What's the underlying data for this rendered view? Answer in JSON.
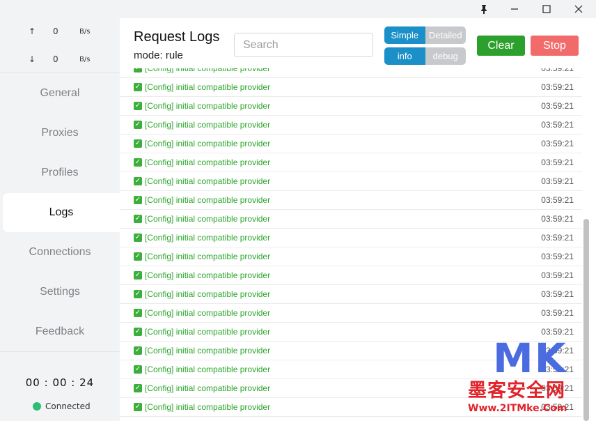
{
  "titlebar": {
    "pin_icon": "pin-icon",
    "minimize_icon": "minimize-icon",
    "maximize_icon": "maximize-icon",
    "close_icon": "close-icon"
  },
  "sidebar": {
    "upload": {
      "arrow": "↑",
      "value": "0",
      "unit": "B/s"
    },
    "download": {
      "arrow": "↓",
      "value": "0",
      "unit": "B/s"
    },
    "items": [
      {
        "label": "General"
      },
      {
        "label": "Proxies"
      },
      {
        "label": "Profiles"
      },
      {
        "label": "Logs"
      },
      {
        "label": "Connections"
      },
      {
        "label": "Settings"
      },
      {
        "label": "Feedback"
      }
    ],
    "active_item": "Logs",
    "timer": "00 : 00 : 24",
    "status": "Connected",
    "status_color": "#2bbf74"
  },
  "header": {
    "title": "Request Logs",
    "mode": "mode: rule",
    "search_placeholder": "Search",
    "view_toggle": {
      "simple": "Simple",
      "detailed": "Detailed",
      "selected": "Simple"
    },
    "level_toggle": {
      "info": "info",
      "debug": "debug",
      "selected": "info"
    },
    "clear_label": "Clear",
    "stop_label": "Stop"
  },
  "logs": [
    {
      "message": "[Config] initial compatible provider",
      "time": "03:59:21"
    },
    {
      "message": "[Config] initial compatible provider",
      "time": "03:59:21"
    },
    {
      "message": "[Config] initial compatible provider",
      "time": "03:59:21"
    },
    {
      "message": "[Config] initial compatible provider",
      "time": "03:59:21"
    },
    {
      "message": "[Config] initial compatible provider",
      "time": "03:59:21"
    },
    {
      "message": "[Config] initial compatible provider",
      "time": "03:59:21"
    },
    {
      "message": "[Config] initial compatible provider",
      "time": "03:59:21"
    },
    {
      "message": "[Config] initial compatible provider",
      "time": "03:59:21"
    },
    {
      "message": "[Config] initial compatible provider",
      "time": "03:59:21"
    },
    {
      "message": "[Config] initial compatible provider",
      "time": "03:59:21"
    },
    {
      "message": "[Config] initial compatible provider",
      "time": "03:59:21"
    },
    {
      "message": "[Config] initial compatible provider",
      "time": "03:59:21"
    },
    {
      "message": "[Config] initial compatible provider",
      "time": "03:59:21"
    },
    {
      "message": "[Config] initial compatible provider",
      "time": "03:59:21"
    },
    {
      "message": "[Config] initial compatible provider",
      "time": "03:59:21"
    },
    {
      "message": "[Config] initial compatible provider",
      "time": "03:59:21"
    },
    {
      "message": "[Config] initial compatible provider",
      "time": "03:59:21"
    },
    {
      "message": "[Config] initial compatible provider",
      "time": "03:59:21"
    },
    {
      "message": "[Config] initial compatible provider",
      "time": "03:59:21"
    }
  ],
  "watermark": {
    "logo": "MK",
    "cn": "墨客安全网",
    "url": "Www.2ITMke.Com"
  }
}
